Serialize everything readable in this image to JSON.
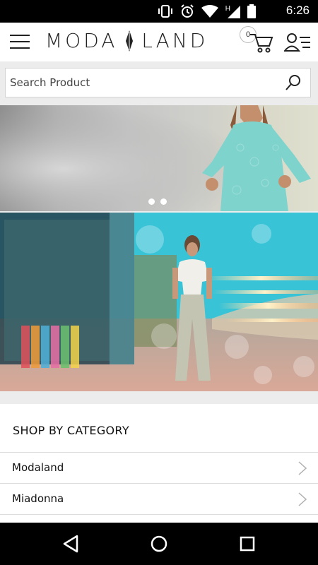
{
  "status_bar": {
    "time": "6:26",
    "icons": [
      "vibrate-icon",
      "alarm-icon",
      "wifi-icon",
      "signal-h-icon",
      "battery-icon"
    ],
    "signal_label": "H"
  },
  "header": {
    "logo_left": "MODA",
    "logo_right": "LAND",
    "cart_count": "0",
    "menu_icon": "hamburger-icon",
    "cart_icon": "cart-icon",
    "account_icon": "account-list-icon"
  },
  "search": {
    "placeholder": "Search Product",
    "value": ""
  },
  "hero_carousel": {
    "slides": 2,
    "active_index": 1
  },
  "categories": {
    "title": "SHOP BY CATEGORY",
    "items": [
      {
        "label": "Modaland"
      },
      {
        "label": "Miadonna"
      }
    ]
  },
  "nav_bar": {
    "items": [
      "back-icon",
      "home-icon",
      "recents-icon"
    ]
  },
  "colors": {
    "accent_black": "#000000",
    "background": "#ececec",
    "text": "#111111"
  }
}
